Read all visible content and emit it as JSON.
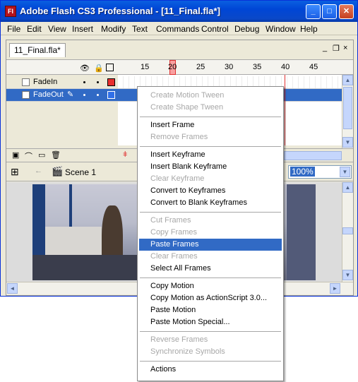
{
  "window": {
    "app_icon": "Fl",
    "title": "Adobe Flash CS3 Professional - [11_Final.fla*]",
    "controls": {
      "minimize": "_",
      "maximize": "□",
      "close": "✕"
    }
  },
  "menubar": [
    "File",
    "Edit",
    "View",
    "Insert",
    "Modify",
    "Text",
    "Commands",
    "Control",
    "Debug",
    "Window",
    "Help"
  ],
  "document": {
    "tab_label": "11_Final.fla*",
    "panel_controls": {
      "minimize": "_",
      "restore": "❐",
      "close": "×"
    }
  },
  "timeline": {
    "header_icons": [
      "eye-icon",
      "lock-icon",
      "outline-icon"
    ],
    "ruler_labels": [
      "15",
      "20",
      "25",
      "30",
      "35",
      "40",
      "45"
    ],
    "current_frame": "20",
    "layers": [
      {
        "name": "FadeIn",
        "color": "#e83030",
        "selected": false
      },
      {
        "name": "FadeOut",
        "color": "#3070e8",
        "selected": true
      }
    ]
  },
  "edit_bar": {
    "scene_label": "Scene 1",
    "zoom": "100%"
  },
  "context_menu": {
    "groups": [
      [
        {
          "label": "Create Motion Tween",
          "enabled": false
        },
        {
          "label": "Create Shape Tween",
          "enabled": false
        }
      ],
      [
        {
          "label": "Insert Frame",
          "enabled": true
        },
        {
          "label": "Remove Frames",
          "enabled": false
        }
      ],
      [
        {
          "label": "Insert Keyframe",
          "enabled": true
        },
        {
          "label": "Insert Blank Keyframe",
          "enabled": true
        },
        {
          "label": "Clear Keyframe",
          "enabled": false
        },
        {
          "label": "Convert to Keyframes",
          "enabled": true
        },
        {
          "label": "Convert to Blank Keyframes",
          "enabled": true
        }
      ],
      [
        {
          "label": "Cut Frames",
          "enabled": false
        },
        {
          "label": "Copy Frames",
          "enabled": false
        },
        {
          "label": "Paste Frames",
          "enabled": true,
          "highlighted": true
        },
        {
          "label": "Clear Frames",
          "enabled": false
        },
        {
          "label": "Select All Frames",
          "enabled": true
        }
      ],
      [
        {
          "label": "Copy Motion",
          "enabled": true
        },
        {
          "label": "Copy Motion as ActionScript 3.0...",
          "enabled": true
        },
        {
          "label": "Paste Motion",
          "enabled": true
        },
        {
          "label": "Paste Motion Special...",
          "enabled": true
        }
      ],
      [
        {
          "label": "Reverse Frames",
          "enabled": false
        },
        {
          "label": "Synchronize Symbols",
          "enabled": false
        }
      ],
      [
        {
          "label": "Actions",
          "enabled": true
        }
      ]
    ]
  },
  "colors": {
    "title_bar": "#0a4ed8",
    "selection": "#316ac5",
    "disabled_text": "#a7a7a7"
  }
}
